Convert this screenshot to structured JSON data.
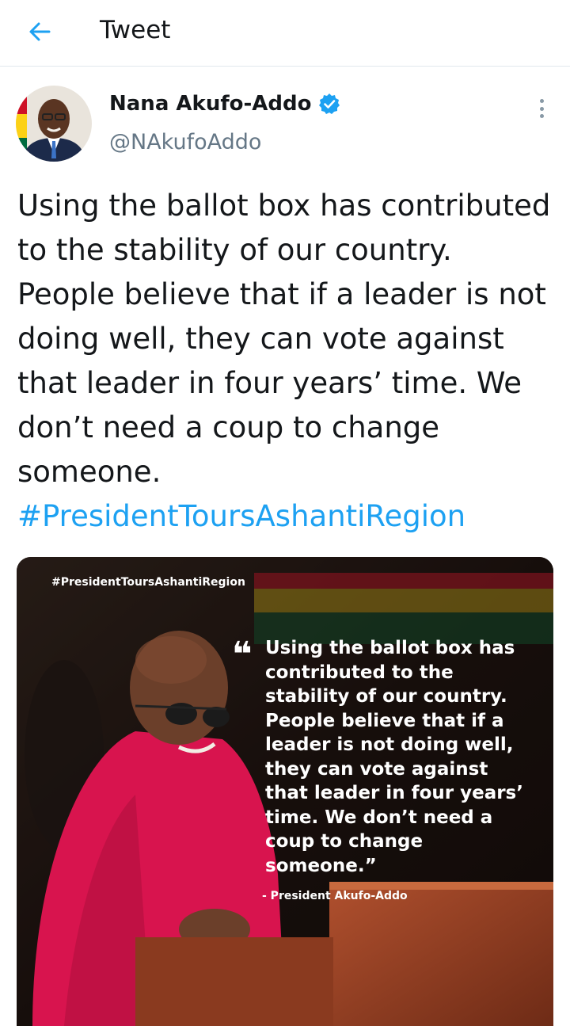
{
  "header": {
    "title": "Tweet",
    "back_icon": "back-arrow-icon"
  },
  "tweet": {
    "author": {
      "name": "Nana Akufo-Addo",
      "handle": "@NAkufoAddo",
      "verified": true
    },
    "text": "Using the ballot box has contributed to the stability of our country. People believe that if a leader is not doing well, they can vote against that leader in four years’ time. We don’t need a coup to change someone.",
    "hashtag": "#PresidentToursAshantiRegion",
    "image": {
      "tag": "#PresidentToursAshantiRegion",
      "quote": "Using the ballot box has contributed to the stability of our country. People believe that if a leader is not doing well, they can vote against that leader in four years’ time. We don’t need a coup to change someone.”",
      "attribution": "- President Akufo-Addo"
    }
  },
  "colors": {
    "accent": "#1da1f2",
    "text": "#14171a",
    "secondary": "#657786",
    "divider": "#e1e8ed",
    "shirt": "#d8144e"
  }
}
